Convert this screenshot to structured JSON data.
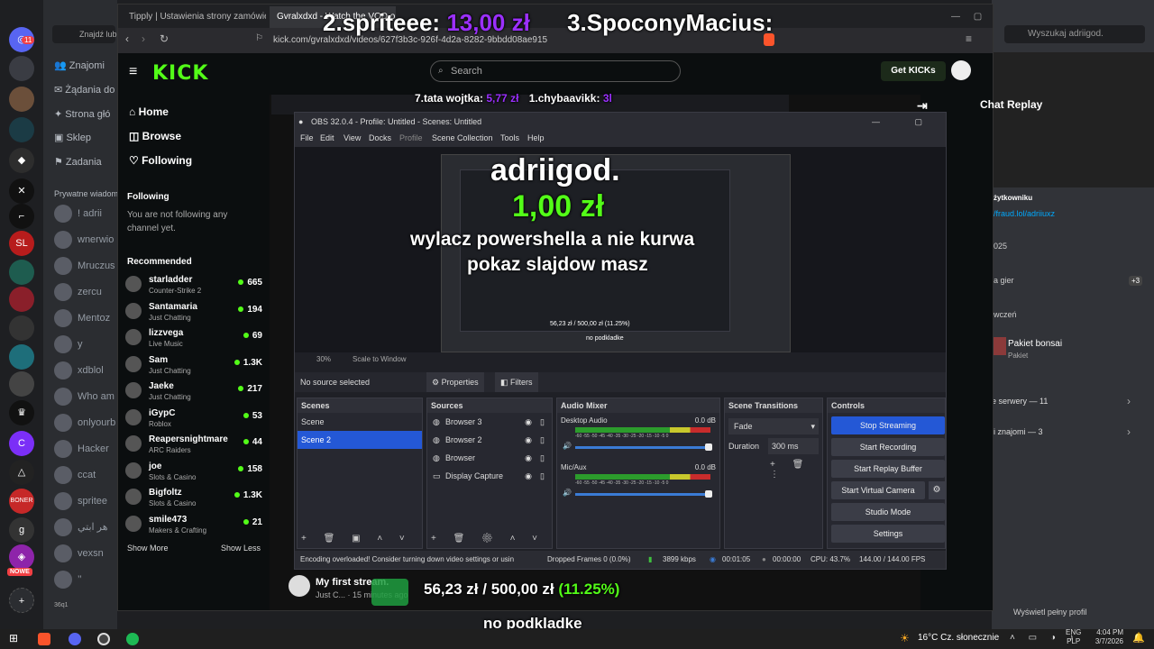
{
  "discord": {
    "dm_nav": [
      "Znajomi",
      "Żądania do",
      "Strona głó",
      "Sklep",
      "Zadania"
    ],
    "dm_section": "Prywatne wiadom",
    "dm_friends": [
      "! adrii",
      "wnerwio",
      "Mruczus",
      "zercu",
      "Mentoz",
      "y",
      "xdblol",
      "Who am",
      "onlyourb",
      "Hacker",
      "ccat",
      "spritee",
      "هر ابتي",
      "vexsn",
      "’’"
    ],
    "badge_count": "11",
    "nowe_label": "NOWE",
    "user_tag": "36q1",
    "right": {
      "user_label": "żytkowniku",
      "link": "/fraud.lol/adriiuxz",
      "year": "025",
      "games_label": "a gier",
      "plus_count": "+3",
      "section_label": "wczeń",
      "pkg_name": "Pakiet bonsai",
      "pkg_sub": "Pakiet",
      "servers": "e serwery — 11",
      "friends": "li znajomi — 3",
      "full_profile": "Wyświetl pełny profil",
      "search_placeholder": "Wyszukaj adriigod.",
      "find_placeholder": "Znajdź lub"
    }
  },
  "browser": {
    "tabs": [
      "Tipply | Ustawienia strony zamówień",
      "Gvralxdxd - Watch the VOD on Kick"
    ],
    "url": "kick.com/gvralxdxd/videos/627f3b3c-926f-4d2a-8282-9bbdd08ae915"
  },
  "kick": {
    "logo": "KICK",
    "search_placeholder": "Search",
    "get_kicks": "Get KICKs",
    "nav": [
      "Home",
      "Browse",
      "Following"
    ],
    "following_title": "Following",
    "following_empty": "You are not following any channel yet.",
    "recommended_title": "Recommended",
    "recommended": [
      {
        "name": "starladder",
        "cat": "Counter-Strike 2",
        "viewers": "665"
      },
      {
        "name": "Santamaria",
        "cat": "Just Chatting",
        "viewers": "194"
      },
      {
        "name": "lizzvega",
        "cat": "Live Music",
        "viewers": "69"
      },
      {
        "name": "Sam",
        "cat": "Just Chatting",
        "viewers": "1.3K"
      },
      {
        "name": "Jaeke",
        "cat": "Just Chatting",
        "viewers": "217"
      },
      {
        "name": "iGypC",
        "cat": "Roblox",
        "viewers": "53"
      },
      {
        "name": "Reapersnightmare",
        "cat": "ARC Raiders",
        "viewers": "44"
      },
      {
        "name": "joe",
        "cat": "Slots & Casino",
        "viewers": "158"
      },
      {
        "name": "Bigfoltz",
        "cat": "Slots & Casino",
        "viewers": "1.3K"
      },
      {
        "name": "smile473",
        "cat": "Makers & Crafting",
        "viewers": "21"
      }
    ],
    "show_more": "Show More",
    "show_less": "Show Less",
    "chat_replay": "Chat Replay",
    "stream_title": "My first stream.",
    "stream_sub": "Just C...",
    "stream_time": "15 minutes ago",
    "letter_m": "M"
  },
  "obs": {
    "title": "OBS 32.0.4 - Profile: Untitled - Scenes: Untitled",
    "menu": [
      "File",
      "Edit",
      "View",
      "Docks",
      "Profile",
      "Scene Collection",
      "Tools",
      "Help"
    ],
    "zoom": "30%",
    "scale": "Scale to Window",
    "no_source": "No source selected",
    "properties": "Properties",
    "filters": "Filters",
    "docks": {
      "scenes_title": "Scenes",
      "scenes": [
        "Scene",
        "Scene 2"
      ],
      "sources_title": "Sources",
      "sources": [
        "Browser 3",
        "Browser 2",
        "Browser",
        "Display Capture"
      ],
      "mixer_title": "Audio Mixer",
      "mixer": [
        {
          "name": "Desktop Audio",
          "db": "0.0 dB"
        },
        {
          "name": "Mic/Aux",
          "db": "0.0 dB"
        }
      ],
      "meter_scale": "-60 -55 -50 -45 -40 -35 -30 -25 -20 -15 -10 -5 0",
      "transitions_title": "Scene Transitions",
      "transition": "Fade",
      "duration_label": "Duration",
      "duration": "300 ms",
      "controls_title": "Controls",
      "controls": [
        "Stop Streaming",
        "Start Recording",
        "Start Replay Buffer",
        "Start Virtual Camera",
        "Studio Mode",
        "Settings"
      ]
    },
    "status": {
      "message": "Encoding overloaded! Consider turning down video settings or usin",
      "dropped": "Dropped Frames 0 (0.0%)",
      "kbps": "3899 kbps",
      "live_time": "00:01:05",
      "rec_time": "00:00:00",
      "cpu": "CPU: 43.7%",
      "fps": "144.00 / 144.00 FPS"
    }
  },
  "overlay": {
    "top_line1_name": "2.spriteee:",
    "top_line1_amount": "13,00 zł",
    "top_line1_name2": "3.SpoconyMacius:",
    "mid_name1": "7.tata wojtka:",
    "mid_amount1": "5,77 zł",
    "mid_name2": "1.chybaavikk:",
    "mid_amount2": "3l",
    "donor": "adriigod.",
    "amount": "1,00 zł",
    "message1": "wylacz powershella a nie kurwa",
    "message2": "pokaz slajdow masz",
    "goal_current": "56,23 zł",
    "goal_sep": "/",
    "goal_target": "500,00 zł",
    "goal_pct": "(11.25%)",
    "goal_progress": 0.1125,
    "bottom_text": "no podkladke",
    "preview_goal": "56,23 zł / 500,00 zł (11.25%)",
    "preview_bottom": "no podkladke"
  },
  "taskbar": {
    "weather_temp": "16°C",
    "weather_desc": "Cz. słonecznie",
    "lang1": "ENG",
    "lang2": "PLP",
    "time": "4:04 PM",
    "date": "3/7/2026"
  },
  "colors": {
    "kick_green": "#53fc18",
    "donation_purple": "#9b30ff",
    "amount_green": "#53fc18",
    "obs_blue": "#2458d6"
  }
}
